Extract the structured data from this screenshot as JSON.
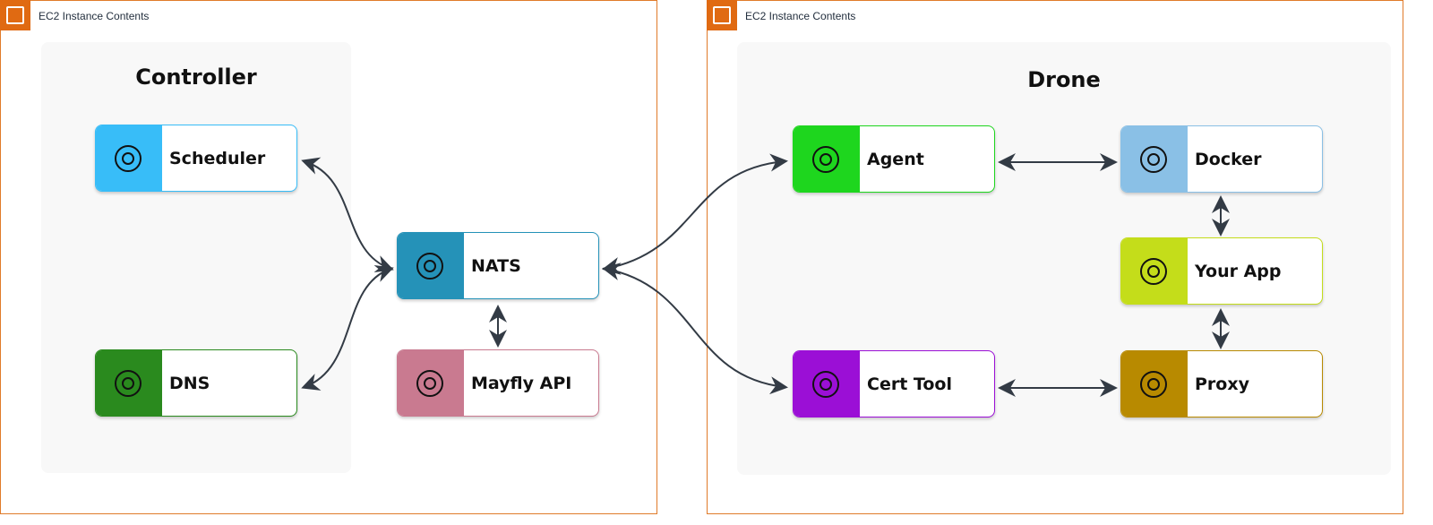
{
  "frames": [
    {
      "title": "EC2 Instance Contents",
      "icon": "chip-icon"
    },
    {
      "title": "EC2 Instance Contents",
      "icon": "chip-icon"
    }
  ],
  "panels": {
    "controller": "Controller",
    "drone": "Drone"
  },
  "nodes": {
    "scheduler": {
      "label": "Scheduler",
      "icon": "gear-clock-icon",
      "color": "#38bdf8"
    },
    "dns": {
      "label": "DNS",
      "icon": "browser-globe-icon",
      "color": "#2a8a1e"
    },
    "nats": {
      "label": "NATS",
      "icon": "network-users-icon",
      "color": "#2592b8"
    },
    "mayfly": {
      "label": "Mayfly API",
      "icon": "mayfly-logo-icon",
      "color": "#c97a90"
    },
    "agent": {
      "label": "Agent",
      "icon": "gear-users-icon",
      "color": "#1ed61e"
    },
    "docker": {
      "label": "Docker",
      "icon": "docker-whale-icon",
      "color": "#8ac0e6"
    },
    "yourapp": {
      "label": "Your App",
      "icon": "app-window-gear-icon",
      "color": "#c4dd1a"
    },
    "certtool": {
      "label": "Cert Tool",
      "icon": "certificate-icon",
      "color": "#9b0fd6"
    },
    "proxy": {
      "label": "Proxy",
      "icon": "shield-globe-icon",
      "color": "#b88a00"
    }
  },
  "edges": [
    [
      "scheduler",
      "nats"
    ],
    [
      "dns",
      "nats"
    ],
    [
      "nats",
      "mayfly"
    ],
    [
      "nats",
      "agent"
    ],
    [
      "nats",
      "certtool"
    ],
    [
      "agent",
      "docker"
    ],
    [
      "docker",
      "yourapp"
    ],
    [
      "yourapp",
      "proxy"
    ],
    [
      "certtool",
      "proxy"
    ]
  ]
}
